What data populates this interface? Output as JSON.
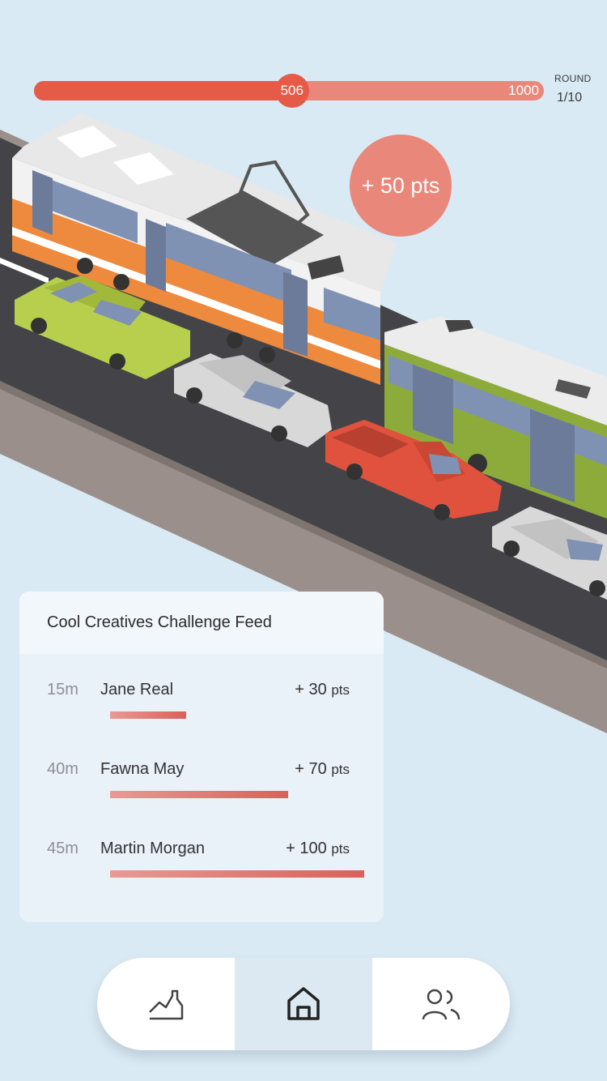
{
  "progress": {
    "current": "506",
    "max": "1000",
    "fraction": 0.506
  },
  "round": {
    "title": "ROUND",
    "value": "1/10"
  },
  "reward_bubble": "+ 50 pts",
  "feed": {
    "title": "Cool Creatives Challenge Feed",
    "entries": [
      {
        "time": "15m",
        "name": "Jane Real",
        "points": "+ 30",
        "unit": "pts",
        "bar_fraction": 0.3
      },
      {
        "time": "40m",
        "name": "Fawna May",
        "points": "+ 70",
        "unit": "pts",
        "bar_fraction": 0.7
      },
      {
        "time": "45m",
        "name": "Martin Morgan",
        "points": "+ 100",
        "unit": "pts",
        "bar_fraction": 1.0
      }
    ]
  },
  "nav": {
    "items": [
      {
        "icon": "chart-trend-icon",
        "active": false
      },
      {
        "icon": "home-icon",
        "active": true
      },
      {
        "icon": "users-icon",
        "active": false
      }
    ]
  },
  "colors": {
    "background": "#d9eaf4",
    "accent": "#e65b48",
    "tram_orange": "#ee8a3e",
    "bus_green": "#8dab3a",
    "car_lime": "#b7cf4c",
    "truck_red": "#e0523d"
  }
}
